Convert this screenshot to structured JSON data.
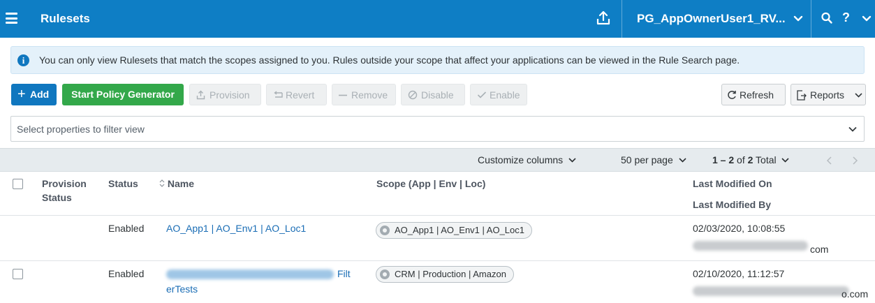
{
  "header": {
    "title": "Rulesets",
    "user": "PG_AppOwnerUser1_RV...",
    "help": "?",
    "icons": [
      "menu-icon",
      "upload-icon",
      "chevron-down-icon",
      "search-icon",
      "help-icon"
    ]
  },
  "banner": {
    "icon": "info-icon",
    "text": "You can only view Rulesets that match the scopes assigned to you. Rules outside your scope that affect your applications can be viewed in the Rule Search page."
  },
  "toolbar": {
    "add": "Add",
    "policy_generator": "Start Policy Generator",
    "provision": "Provision",
    "revert": "Revert",
    "remove": "Remove",
    "disable": "Disable",
    "enable": "Enable",
    "refresh": "Refresh",
    "reports": "Reports"
  },
  "filter": {
    "placeholder": "Select properties to filter view"
  },
  "table_toolbar": {
    "customize": "Customize columns",
    "per_page": "50 per page",
    "range": "1 – 2",
    "of": "of",
    "total_count": "2",
    "total": "Total"
  },
  "columns": {
    "provision_status_1": "Provision",
    "provision_status_2": "Status",
    "status": "Status",
    "name": "Name",
    "scope": "Scope (App | Env | Loc)",
    "last_modified_on": "Last Modified On",
    "last_modified_by": "Last Modified By"
  },
  "rows": [
    {
      "status": "Enabled",
      "name": "AO_App1 | AO_Env1 | AO_Loc1",
      "scope": "AO_App1 | AO_Env1 | AO_Loc1",
      "modified_on": "02/03/2020, 10:08:55",
      "modified_by_suffix": "com"
    },
    {
      "status": "Enabled",
      "name_visible_end": "Filt",
      "name_line2": "erTests",
      "scope": "CRM | Production | Amazon",
      "modified_on": "02/10/2020, 11:12:57",
      "modified_by_suffix": "o.com"
    }
  ],
  "colors": {
    "header_bg": "#0e7ec5",
    "add_button": "#1077bf",
    "generator_button": "#33a84a",
    "link": "#1a6db5",
    "banner_bg": "#e4f1fa"
  }
}
